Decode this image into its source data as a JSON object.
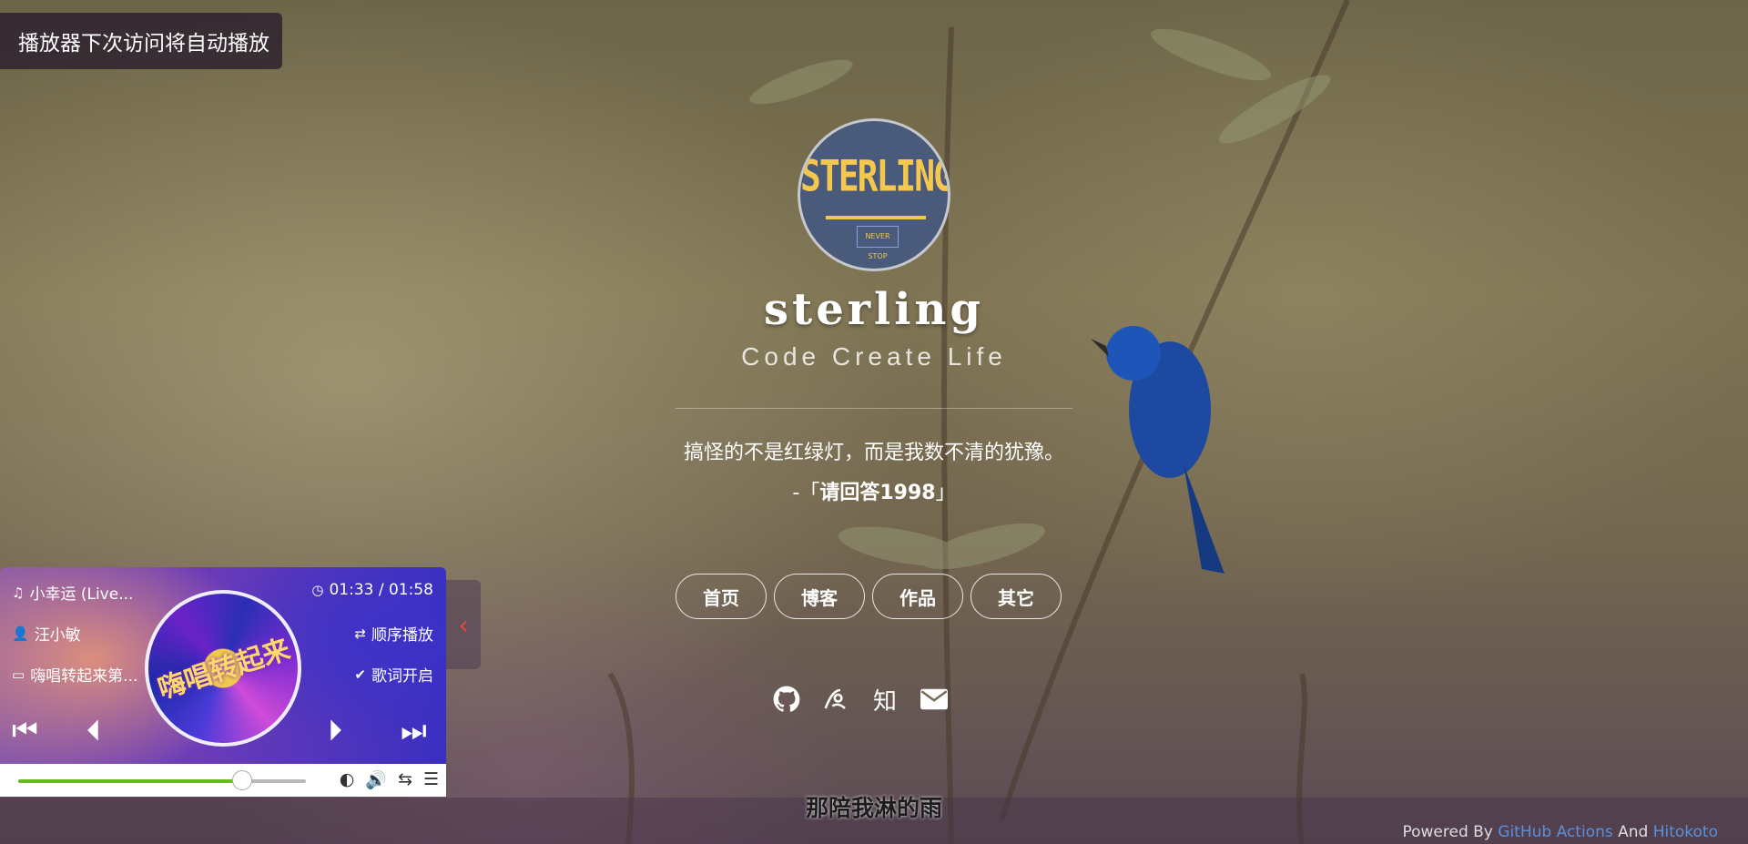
{
  "toast": {
    "text": "播放器下次访问将自动播放"
  },
  "profile": {
    "avatar_brand": "STERLING",
    "avatar_tag": "NEVER STOP",
    "name": "sterling",
    "motto": "Code Create Life"
  },
  "quote": {
    "text": "搞怪的不是红绿灯，而是我数不清的犹豫。",
    "source_prefix": "-「",
    "source": "请回答1998",
    "source_suffix": "」"
  },
  "nav": {
    "items": [
      {
        "label": "首页"
      },
      {
        "label": "博客"
      },
      {
        "label": "作品"
      },
      {
        "label": "其它"
      }
    ]
  },
  "social": {
    "icons": [
      "github-icon",
      "yuque-icon",
      "zhihu-icon",
      "mail-icon"
    ],
    "zhihu_label": "知"
  },
  "player": {
    "song": "小幸运 (Live...",
    "time": "01:33 / 01:58",
    "artist": "汪小敏",
    "mode": "顺序播放",
    "album": "嗨唱转起来第...",
    "lyrics_state": "歌词开启",
    "cover_text": "嗨唱转起来",
    "progress": 0.78,
    "toggle_icon": "chevron-left-icon"
  },
  "lyric_line": "那陪我淋的雨",
  "footer": {
    "powered_by": "Powered By",
    "link1": "GitHub Actions",
    "and": "And",
    "link2": "Hitokoto"
  },
  "colors": {
    "progress_fill": "#66bb22",
    "link": "#5b8fdc",
    "toggle_arrow": "#e84a3a",
    "avatar_bg": "#4a5a7a",
    "brand_yellow": "#f4c84e"
  }
}
